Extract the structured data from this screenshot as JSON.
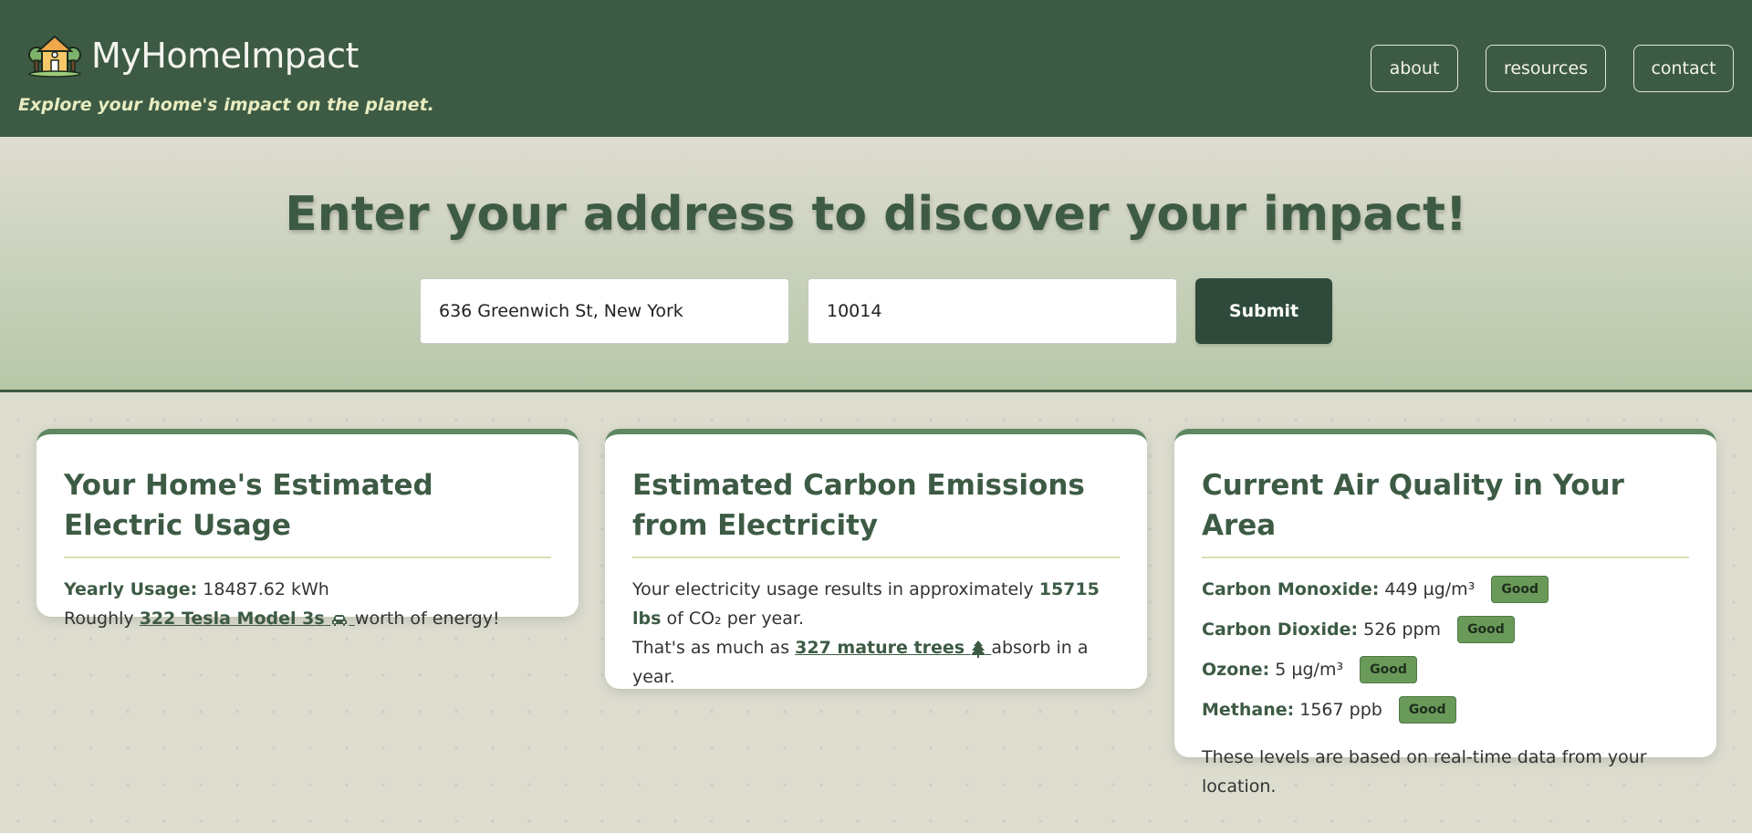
{
  "header": {
    "site_title": "MyHomeImpact",
    "tagline": "Explore your home's impact on the planet.",
    "nav": [
      {
        "label": "about"
      },
      {
        "label": "resources"
      },
      {
        "label": "contact"
      }
    ],
    "bg_color": "#3d5b44"
  },
  "hero": {
    "title": "Enter your address to discover your impact!",
    "address_value": "636 Greenwich St, New York",
    "zip_value": "10014",
    "submit_label": "Submit"
  },
  "cards": {
    "electric": {
      "title": "Your Home's Estimated Electric Usage",
      "yearly_label": "Yearly Usage:",
      "yearly_value": "18487.62 kWh",
      "roughly_prefix": "Roughly",
      "tesla_link": "322 Tesla Model 3s",
      "roughly_suffix": "worth of energy!"
    },
    "carbon": {
      "title": "Estimated Carbon Emissions from Electricity",
      "line1_prefix": "Your electricity usage results in approximately",
      "lbs_value": "15715 lbs",
      "line1_suffix": "of CO₂ per year.",
      "line2_prefix": "That's as much as",
      "trees_link": "327 mature trees",
      "line2_suffix": "absorb in a year."
    },
    "air": {
      "title": "Current Air Quality in Your Area",
      "rows": [
        {
          "label": "Carbon Monoxide:",
          "value": "449 µg/m³",
          "status": "Good"
        },
        {
          "label": "Carbon Dioxide:",
          "value": "526 ppm",
          "status": "Good"
        },
        {
          "label": "Ozone:",
          "value": "5 µg/m³",
          "status": "Good"
        },
        {
          "label": "Methane:",
          "value": "1567 ppb",
          "status": "Good"
        }
      ],
      "note": "These levels are based on real-time data from your location."
    }
  },
  "icons": {
    "logo": "house-trees-icon",
    "car": "car-icon",
    "tree": "tree-icon"
  },
  "colors": {
    "primary_green": "#3d5b44",
    "badge_green": "#6a9a59",
    "accent_underline": "#d8e0b0"
  }
}
